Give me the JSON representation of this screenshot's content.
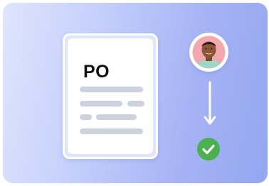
{
  "document": {
    "title": "PO"
  },
  "colors": {
    "card_gradient_start": "#dfe5fd",
    "card_gradient_end": "#95a6f1",
    "document_border": "#ffffff",
    "placeholder_lines": "#cdd2de",
    "arrow": "#ffffff",
    "check_badge": "#4caf50"
  },
  "icons": {
    "document": "document-icon",
    "avatar": "user-avatar",
    "arrow": "arrow-down-icon",
    "check": "check-circle-icon"
  }
}
